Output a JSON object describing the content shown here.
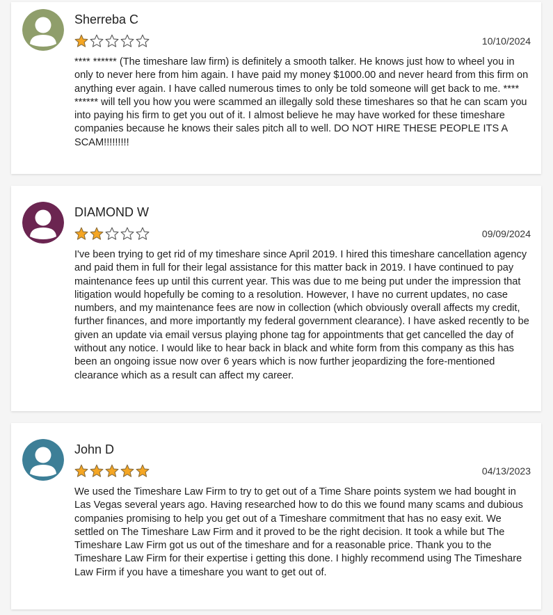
{
  "colors": {
    "star_fill": "#f5a623",
    "star_stroke": "#8a6d3b",
    "star_empty": "#ffffff"
  },
  "reviews": [
    {
      "name": "Sherreba C",
      "rating": 1,
      "date": "10/10/2024",
      "avatar_color": "#8f9e6b",
      "text": "**** ****** (The timeshare law firm) is definitely a smooth talker. He knows just how to wheel you in only to never here from him again. I have paid my money $1000.00 and never heard from this firm on anything ever again. I have called numerous times to only be told someone will get back to me. **** ****** will tell you how you were scammed an illegally sold these timeshares so that he can scam you into paying his firm to get you out of it. I almost believe he may have worked for these timeshare companies because he knows their sales pitch all to well. DO NOT HIRE THESE PEOPLE ITS A SCAM!!!!!!!!!"
    },
    {
      "name": "DIAMOND W",
      "rating": 2,
      "date": "09/09/2024",
      "avatar_color": "#6b2551",
      "text": "I've been trying to get rid of my timeshare since April 2019. I hired this timeshare cancellation agency and paid them in full for their legal assistance for this matter back in 2019. I have continued to pay maintenance fees up until this current year. This was due to me being put under the impression that litigation would hopefully be coming to a resolution. However, I have no current updates, no case numbers, and my maintenance fees are now in collection (which obviously overall affects my credit, further finances, and more importantly my federal government clearance). I have asked recently to be given an update via email versus playing phone tag for appointments that get cancelled the day of without any notice. I would like to hear back in black and white form from this company as this has been an ongoing issue now over 6 years which is now further jeopardizing the fore-mentioned clearance which as a result can affect my career."
    },
    {
      "name": "John D",
      "rating": 5,
      "date": "04/13/2023",
      "avatar_color": "#3d7f97",
      "text": "We used the Timeshare Law Firm to try to get out of a Time Share points system we had bought in Las Vegas several years ago. Having researched how to do this we found many scams and dubious companies promising to help you get out of a Timeshare commitment that has no easy exit. We settled on The Timeshare Law Firm and it proved to be the right decision. It took a while but The Timeshare Law Firm got us out of the timeshare and for a reasonable price. Thank you to the Timeshare Law Firm for their expertise i getting this done. I highly recommend using The Timeshare Law Firm if you have a timeshare you want to get out of."
    }
  ]
}
